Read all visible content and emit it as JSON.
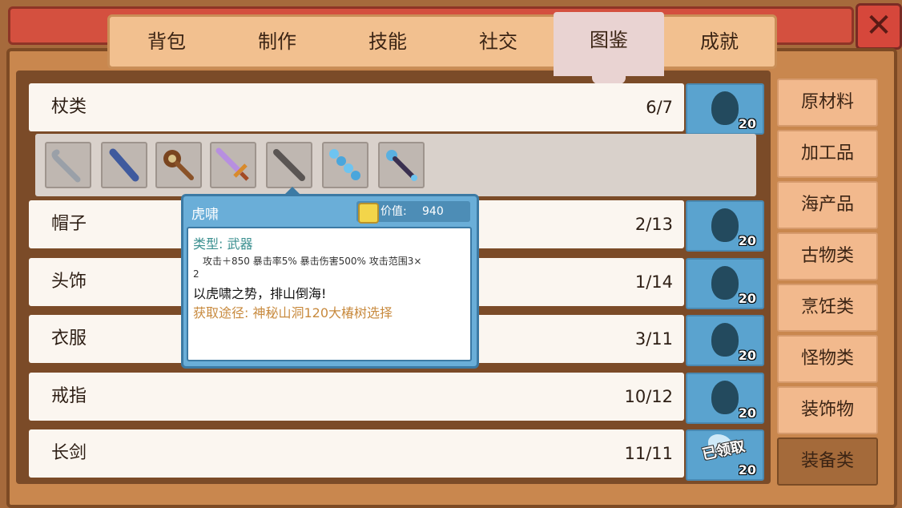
{
  "tabs": [
    "背包",
    "制作",
    "技能",
    "社交",
    "图鉴",
    "成就"
  ],
  "active_tab": "图鉴",
  "close_label": "✕",
  "rows": [
    {
      "name": "杖类",
      "count": "6/7",
      "reward": "20"
    },
    {
      "name": "帽子",
      "count": "2/13",
      "reward": "20"
    },
    {
      "name": "头饰",
      "count": "1/14",
      "reward": "20"
    },
    {
      "name": "衣服",
      "count": "3/11",
      "reward": "20"
    },
    {
      "name": "戒指",
      "count": "10/12",
      "reward": "20"
    },
    {
      "name": "长剑",
      "count": "11/11",
      "reward": "20",
      "claimed": "已领取"
    }
  ],
  "items": [
    "pipe-staff-icon",
    "blue-club-icon",
    "spiked-mace-icon",
    "crystal-sword-icon",
    "iron-rod-icon",
    "ice-chain-staff-icon",
    "dark-orb-staff-icon"
  ],
  "categories": [
    "原材料",
    "加工品",
    "海产品",
    "古物类",
    "烹饪类",
    "怪物类",
    "装饰物",
    "装备类"
  ],
  "active_category": "装备类",
  "tooltip": {
    "title": "虎啸",
    "value_label": "价值:",
    "value": "940",
    "type": "类型: 武器",
    "stats": "攻击＋850    暴击率5%    暴击伤害500%    攻击范围3×",
    "stats_wrap": "2",
    "desc": "以虎啸之势，排山倒海!",
    "source": "获取途径: 神秘山洞120大椿树选择"
  }
}
